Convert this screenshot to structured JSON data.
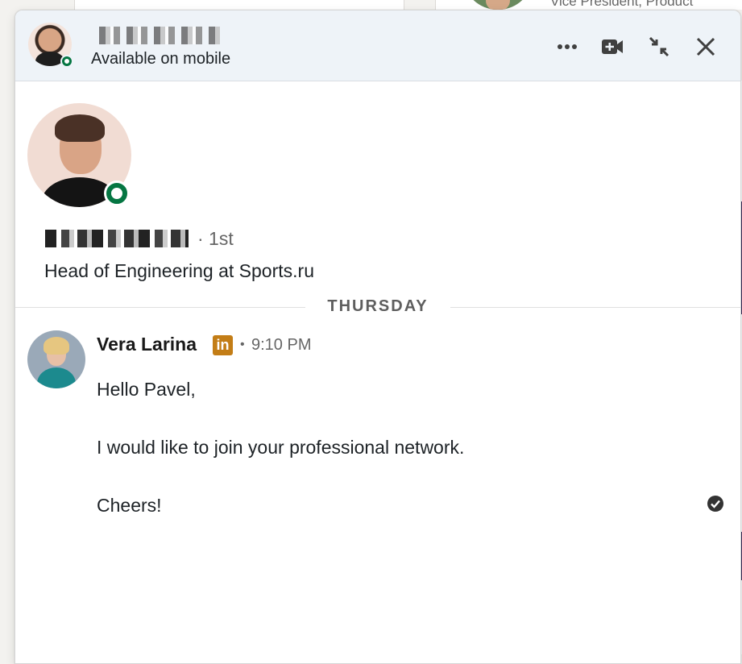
{
  "background": {
    "partial_text": "Vice President, Product"
  },
  "chat": {
    "header": {
      "status_text": "Available on mobile",
      "icons": [
        "more-icon",
        "video-icon",
        "minimize-icon",
        "close-icon"
      ]
    },
    "profile": {
      "degree": "· 1st",
      "headline": "Head of Engineering at Sports.ru"
    },
    "day_divider": "THURSDAY",
    "message": {
      "sender": "Vera Larina",
      "badge": "in",
      "separator": "•",
      "time": "9:10 PM",
      "lines": [
        "Hello Pavel,",
        "I would like to join your professional network.",
        "Cheers!"
      ]
    },
    "colors": {
      "online_green": "#057642",
      "header_bg": "#eef3f8",
      "premium_gold": "#c37d16"
    }
  }
}
